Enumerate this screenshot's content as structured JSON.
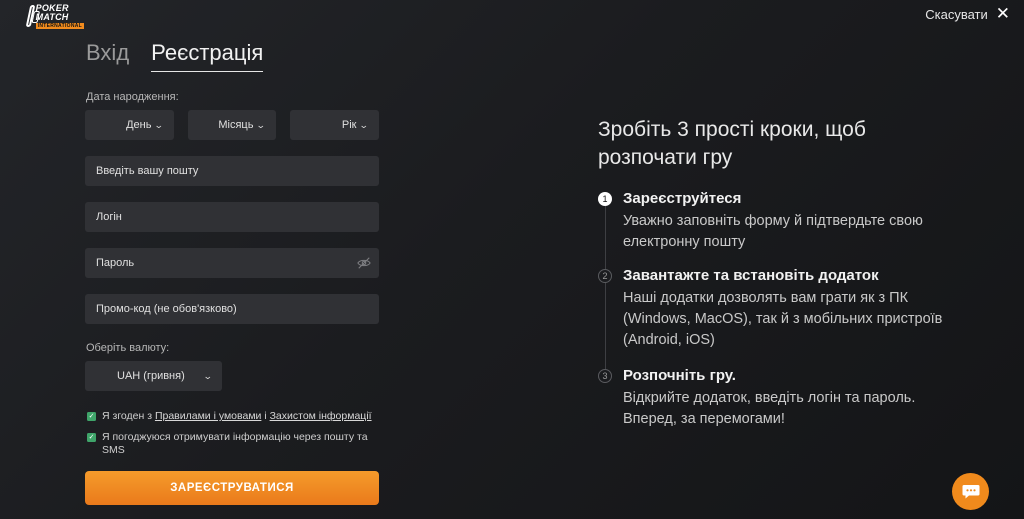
{
  "brand": {
    "line1": "POKER",
    "line2": "MATCH",
    "line3": "INTERNATIONAL"
  },
  "header": {
    "cancel_label": "Скасувати",
    "close_symbol": "✕"
  },
  "tabs": [
    {
      "label": "Вхід"
    },
    {
      "label": "Реєстрація"
    }
  ],
  "form": {
    "birth_label": "Дата народження:",
    "day": "День",
    "month": "Місяць",
    "year": "Рік",
    "email_placeholder": "Введіть вашу пошту",
    "login_placeholder": "Логін",
    "password_placeholder": "Пароль",
    "promo_placeholder": "Промо-код (не обов'язково)",
    "currency_label": "Оберіть валюту:",
    "currency_value": "UAH (гривня)",
    "agree_prefix": "Я згоден з ",
    "agree_link1": "Правилами і умовами",
    "agree_mid": " і ",
    "agree_link2": "Захистом інформації",
    "newsletter": "Я погоджуюся отримувати інформацію через пошту та SMS",
    "submit_label": "ЗАРЕЄСТРУВАТИСЯ"
  },
  "info": {
    "headline": "Зробіть 3 прості кроки, щоб розпочати гру",
    "steps": [
      {
        "num": "1",
        "title": "Зареєструйтеся",
        "desc": "Уважно заповніть форму й підтвердьте свою електронну пошту"
      },
      {
        "num": "2",
        "title": "Завантажте та встановіть додаток",
        "desc": "Наші додатки дозволять вам грати як з ПК (Windows, MacOS), так й з мобільних пристроїв (Android, iOS)"
      },
      {
        "num": "3",
        "title": "Розпочніть гру.",
        "desc": "Відкрийте додаток, введіть логін та пароль. Вперед, за перемогами!"
      }
    ]
  },
  "colors": {
    "accent": "#f08a1c",
    "check": "#3fa46a",
    "field_bg": "#303135"
  },
  "icons": {
    "chat": "chat-bubble-icon",
    "eye": "eye-slash-icon",
    "chevron": "chevron-down-icon"
  }
}
